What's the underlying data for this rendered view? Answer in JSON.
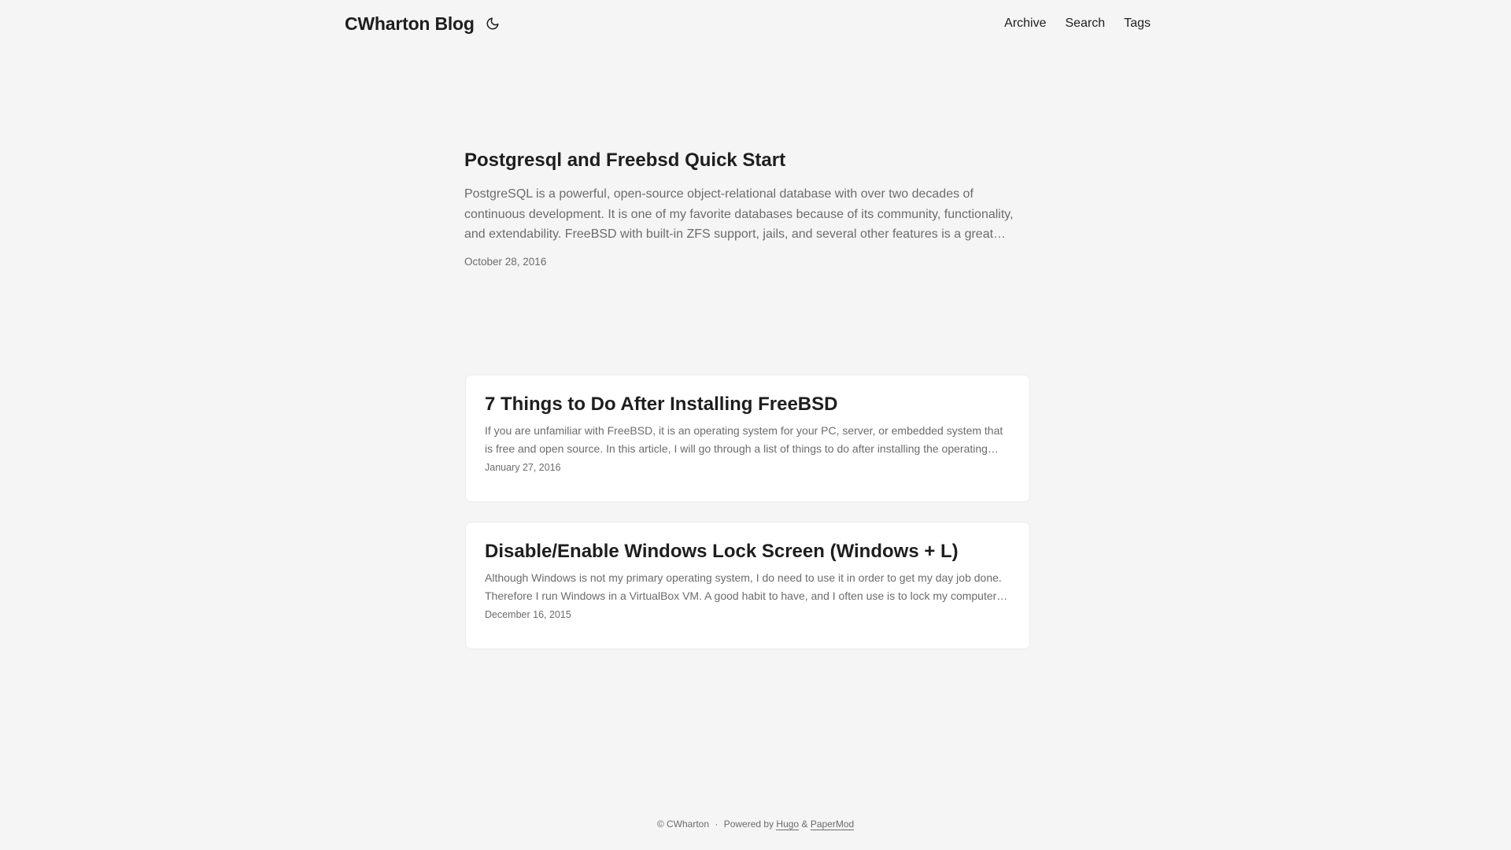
{
  "header": {
    "logo": "CWharton Blog",
    "theme_toggle_icon": "moon-icon",
    "menu": [
      {
        "label": "Archive"
      },
      {
        "label": "Search"
      },
      {
        "label": "Tags"
      }
    ]
  },
  "first_entry": {
    "title": "Postgresql and Freebsd Quick Start",
    "summary": "PostgreSQL is a powerful, open-source object-relational database with over two decades of continuous development. It is one of my favorite databases because of its community, functionality, and extendability. FreeBSD with built-in ZFS support, jails, and several other features is a great…",
    "date": "October 28, 2016"
  },
  "posts": [
    {
      "title": "7 Things to Do After Installing FreeBSD",
      "summary": "If you are unfamiliar with FreeBSD, it is an operating system for your PC, server, or embedded system that is free and open source. In this article, I will go through a list of things to do after installing the operating…",
      "date": "January 27, 2016"
    },
    {
      "title": "Disable/Enable Windows Lock Screen (Windows + L)",
      "summary": "Although Windows is not my primary operating system, I do need to use it in order to get my day job done. Therefore I run Windows in a VirtualBox VM. A good habit to have, and I often use is to lock my computer…",
      "date": "December 16, 2015"
    }
  ],
  "footer": {
    "copyright": "© CWharton",
    "separator": "·",
    "powered_by": "Powered by",
    "hugo": "Hugo",
    "amp": "&",
    "papermod": "PaperMod"
  }
}
